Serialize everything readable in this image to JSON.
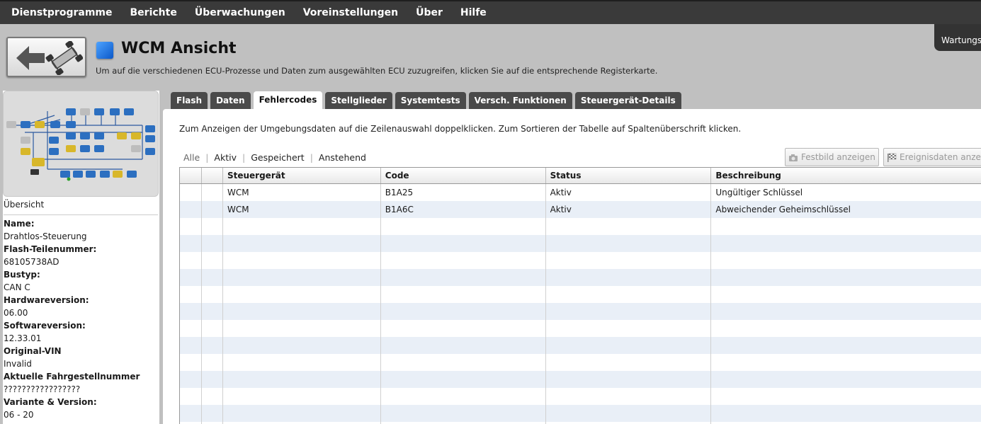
{
  "menu": [
    "Dienstprogramme",
    "Berichte",
    "Überwachungen",
    "Voreinstellungen",
    "Über",
    "Hilfe"
  ],
  "maintenance_tab": "Wartungsi",
  "header": {
    "title": "WCM Ansicht",
    "subtitle": "Um auf die verschiedenen ECU-Prozesse und Daten zum ausgewählten ECU zuzugreifen, klicken Sie auf die entsprechende Registerkarte."
  },
  "left_panel": {
    "overview_label": "Übersicht",
    "fields": [
      {
        "label": "Name:",
        "value": "Drahtlos-Steuerung"
      },
      {
        "label": "Flash-Teilenummer:",
        "value": "68105738AD"
      },
      {
        "label": "Bustyp:",
        "value": "CAN C"
      },
      {
        "label": "Hardwareversion:",
        "value": "06.00"
      },
      {
        "label": "Softwareversion:",
        "value": "12.33.01"
      },
      {
        "label": "Original-VIN",
        "value": "Invalid"
      },
      {
        "label": "Aktuelle Fahrgestellnummer",
        "value": "?????????????????"
      },
      {
        "label": "Variante & Version:",
        "value": "06 - 20"
      }
    ]
  },
  "tabs": [
    "Flash",
    "Daten",
    "Fehlercodes",
    "Stellglieder",
    "Systemtests",
    "Versch. Funktionen",
    "Steuergerät-Details"
  ],
  "active_tab": "Fehlercodes",
  "content": {
    "hint": "Zum Anzeigen der Umgebungsdaten auf die Zeilenauswahl doppelklicken.  Zum Sortieren der Tabelle auf Spaltenüberschrift klicken.",
    "filters": [
      "Alle",
      "Aktiv",
      "Gespeichert",
      "Anstehend"
    ],
    "buttons": {
      "freeze_frame": "Festbild anzeigen",
      "event_data": "Ereignisdaten anzeig"
    }
  },
  "table": {
    "columns": [
      "",
      "",
      "Steuergerät",
      "Code",
      "Status",
      "Beschreibung"
    ],
    "rows": [
      [
        "",
        "",
        "WCM",
        "B1A25",
        "Aktiv",
        "Ungültiger Schlüssel"
      ],
      [
        "",
        "",
        "WCM",
        "B1A6C",
        "Aktiv",
        "Abweichender Geheimschlüssel"
      ],
      [
        "",
        "",
        "",
        "",
        "",
        ""
      ],
      [
        "",
        "",
        "",
        "",
        "",
        ""
      ],
      [
        "",
        "",
        "",
        "",
        "",
        ""
      ],
      [
        "",
        "",
        "",
        "",
        "",
        ""
      ],
      [
        "",
        "",
        "",
        "",
        "",
        ""
      ],
      [
        "",
        "",
        "",
        "",
        "",
        ""
      ],
      [
        "",
        "",
        "",
        "",
        "",
        ""
      ],
      [
        "",
        "",
        "",
        "",
        "",
        ""
      ],
      [
        "",
        "",
        "",
        "",
        "",
        ""
      ],
      [
        "",
        "",
        "",
        "",
        "",
        ""
      ],
      [
        "",
        "",
        "",
        "",
        "",
        ""
      ],
      [
        "",
        "",
        "",
        "",
        "",
        ""
      ],
      [
        "",
        "",
        "",
        "",
        "",
        ""
      ]
    ]
  }
}
